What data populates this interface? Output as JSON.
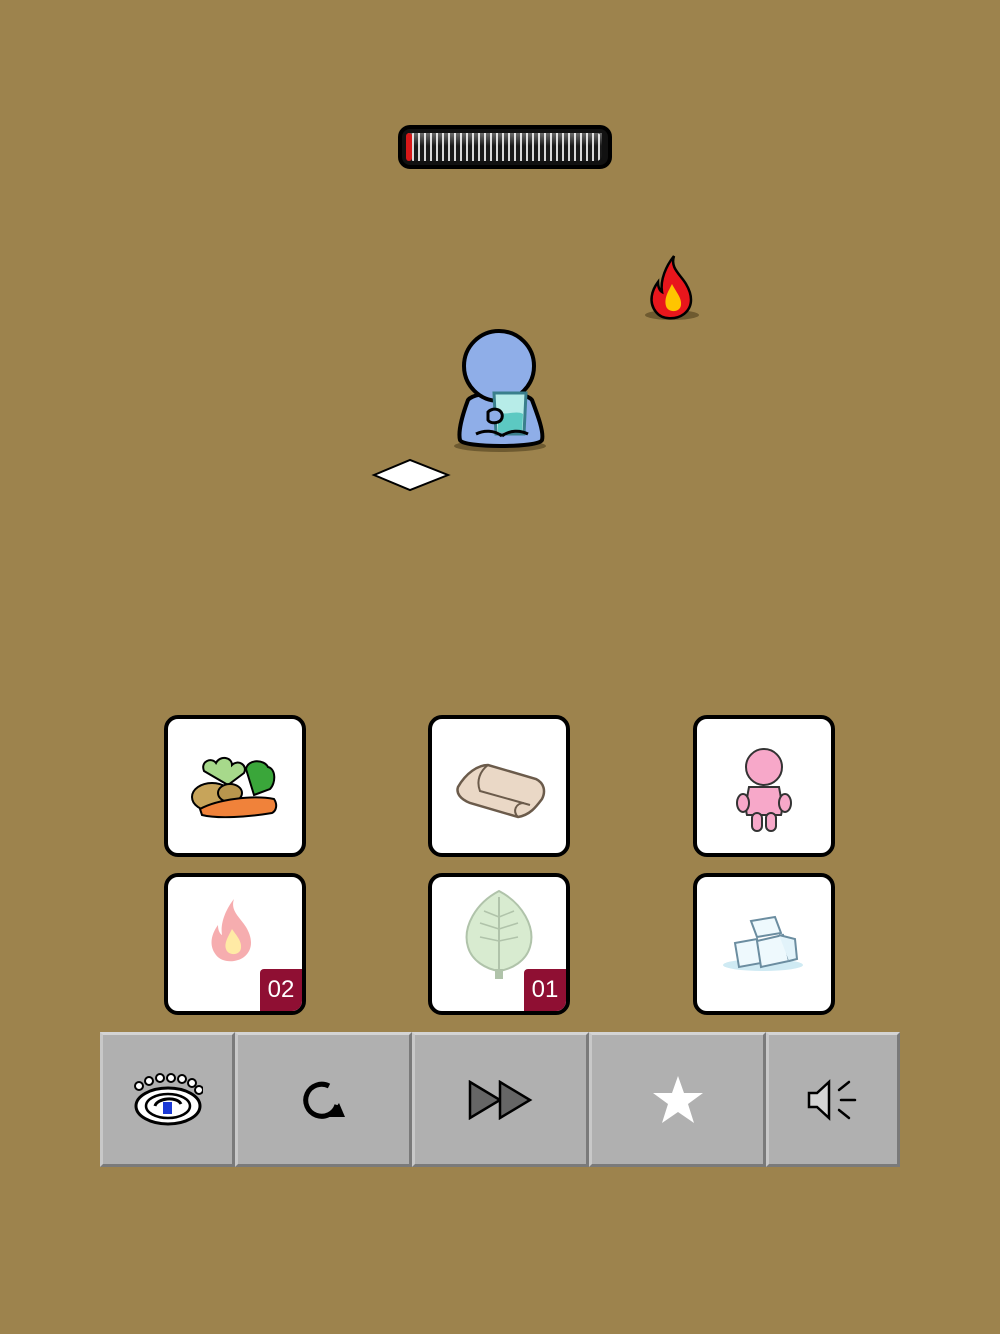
{
  "hud": {
    "heat_meter": {
      "level_fraction": 0.03,
      "fill_color": "#d81818"
    }
  },
  "scene": {
    "character": {
      "color": "#8faee8",
      "holding": "glass-of-water"
    },
    "fire": {
      "color": "#e8161c",
      "inner_color": "#ffc400"
    },
    "paper_note": {
      "color": "#ffffff"
    },
    "background_color": "#9d834d"
  },
  "inventory": [
    {
      "id": "vegetables",
      "icon": "vegetables-icon",
      "count": ""
    },
    {
      "id": "towel",
      "icon": "towel-icon",
      "count": ""
    },
    {
      "id": "pink-doll",
      "icon": "pink-doll-icon",
      "count": ""
    },
    {
      "id": "fire",
      "icon": "fire-icon",
      "count": "02"
    },
    {
      "id": "leaf",
      "icon": "leaf-icon",
      "count": "01"
    },
    {
      "id": "ice",
      "icon": "ice-cubes-icon",
      "count": ""
    }
  ],
  "toolbar": {
    "buttons": [
      {
        "id": "logo",
        "icon": "app-logo-icon"
      },
      {
        "id": "restart",
        "icon": "restart-icon"
      },
      {
        "id": "skip",
        "icon": "fast-forward-icon"
      },
      {
        "id": "favorite",
        "icon": "star-icon"
      },
      {
        "id": "sound",
        "icon": "speaker-icon"
      }
    ]
  }
}
